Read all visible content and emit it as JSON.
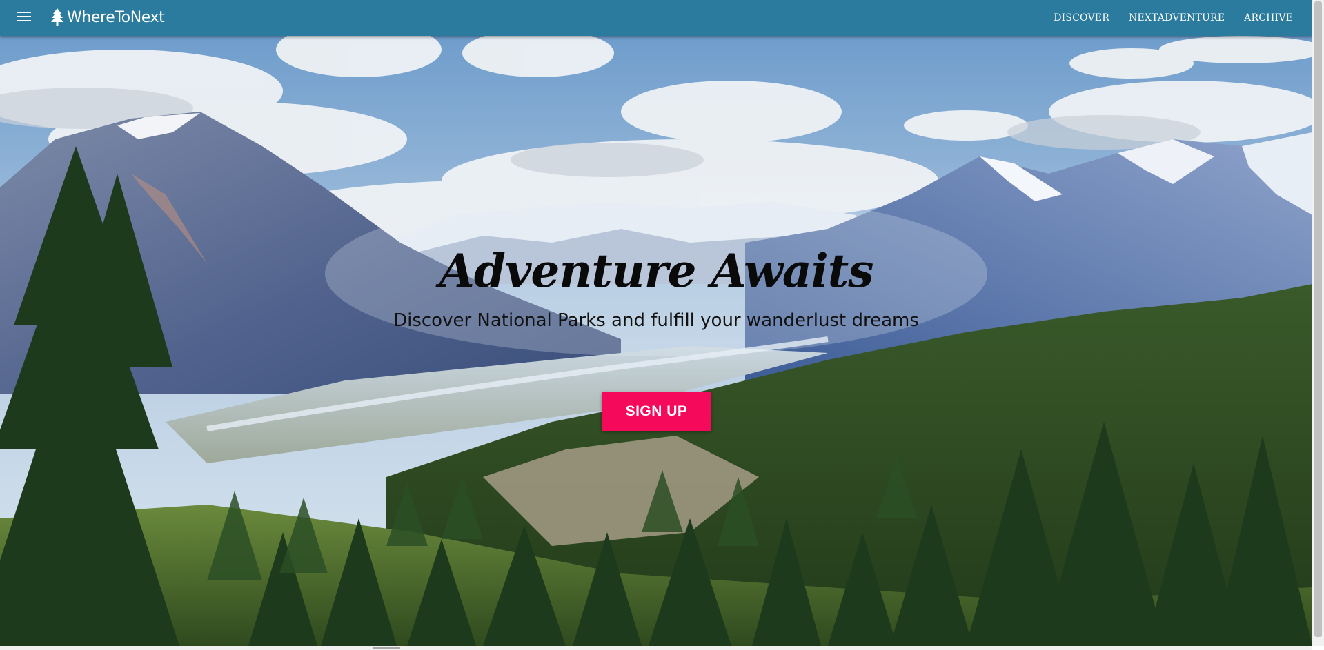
{
  "navbar": {
    "brand": "WhereToNext",
    "menu_icon": "hamburger-menu-icon",
    "brand_icon": "pine-tree-icon",
    "links": [
      "DISCOVER",
      "NEXTADVENTURE",
      "ARCHIVE"
    ],
    "background": "#2a7b9e"
  },
  "hero": {
    "title": "Adventure Awaits",
    "subtitle": "Discover National Parks and fulfill your wanderlust dreams",
    "cta_label": "SIGN UP",
    "cta_color": "#f5095a",
    "background_image": "mountain-valley-forest-photo"
  }
}
